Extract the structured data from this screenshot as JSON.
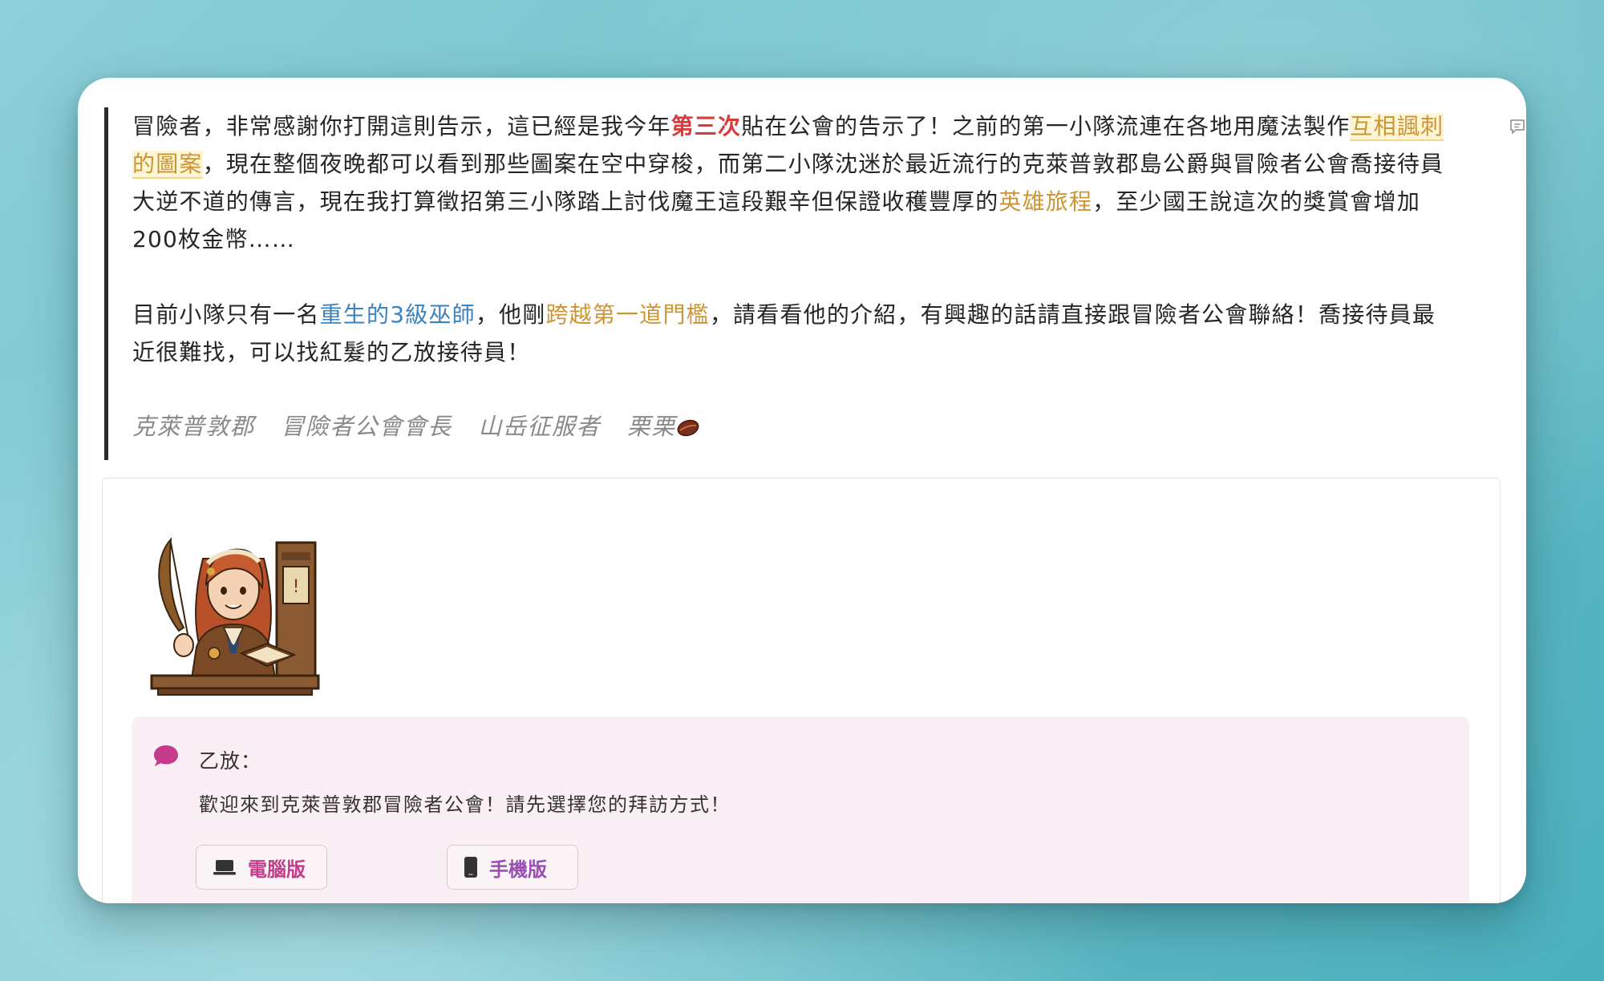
{
  "post": {
    "p1": {
      "t1": "冒險者，非常感謝你打開這則告示，這已經是我今年",
      "red": "第三次",
      "t2": "貼在公會的告示了！之前的第一小隊流連在各地用魔法製作",
      "hl": "互相諷刺的圖案",
      "t3": "，現在整個夜晚都可以看到那些圖案在空中穿梭，而第二小隊沈迷於最近流行的克萊普敦郡島公爵與冒險者公會喬接待員大逆不道的傳言，現在我打算徵招第三小隊踏上討伐魔王這段艱辛但保證收穫豐厚的",
      "gold": "英雄旅程",
      "t4": "，至少國王說這次的獎賞會增加200枚金幣……"
    },
    "p2": {
      "t1": "目前小隊只有一名",
      "blue": "重生的3級巫師",
      "t2": "，他剛",
      "gold": "跨越第一道門檻",
      "t3": "，請看看他的介紹，有興趣的話請直接跟冒險者公會聯絡！喬接待員最近很難找，可以找紅髮的乙放接待員！"
    },
    "signature": [
      "克萊普敦郡",
      "冒險者公會會長",
      "山岳征服者",
      "栗栗"
    ]
  },
  "icons": {
    "comment": "comment-icon",
    "bean": "bean-icon",
    "speech": "speech-bubble-icon",
    "laptop": "laptop-icon",
    "phone": "phone-icon"
  },
  "dialog": {
    "speaker": "乙放：",
    "message": "歡迎來到克萊普敦郡冒險者公會！請先選擇您的拜訪方式！",
    "buttons": {
      "pc": "電腦版",
      "mobile": "手機版"
    }
  },
  "colors": {
    "red_emphasis": "#d93a3a",
    "gold_link": "#cc9535",
    "blue_link": "#3b82c0",
    "dialog_bg": "#fbeff6",
    "pc_button": "#c43c8a",
    "mobile_button": "#9a4fb3"
  }
}
